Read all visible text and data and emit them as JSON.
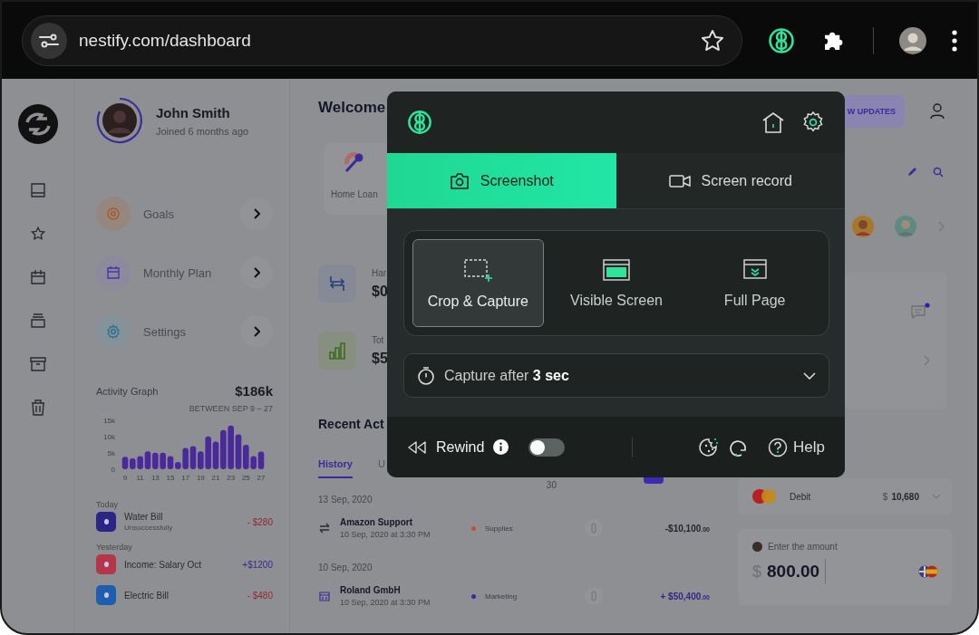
{
  "browser": {
    "url": "nestify.com/dashboard",
    "bookmarked": false
  },
  "profile": {
    "name": "John Smith",
    "joined": "Joined 6 months ago",
    "menu": [
      {
        "label": "Goals",
        "kind": "target"
      },
      {
        "label": "Monthly Plan",
        "kind": "calendar"
      },
      {
        "label": "Settings",
        "kind": "gear"
      }
    ]
  },
  "activity": {
    "title": "Activity Graph",
    "total": "$186k",
    "range": "BETWEEN SEP 9 – 27",
    "chart_data": {
      "type": "bar",
      "x": [
        9,
        10,
        11,
        12,
        13,
        14,
        15,
        16,
        17,
        18,
        19,
        20,
        21,
        22,
        23,
        24,
        25,
        26,
        27
      ],
      "values": [
        3.8,
        3.3,
        4.0,
        5.5,
        5.1,
        5.1,
        4.0,
        2.2,
        6.5,
        7.1,
        5.5,
        10.1,
        8.5,
        12.0,
        13.4,
        10.7,
        7.5,
        4.0,
        5.4
      ],
      "xlim": [
        9,
        27
      ],
      "ylim": [
        0,
        15
      ],
      "yticks": [
        {
          "value": 0,
          "label": "0"
        },
        {
          "value": 5,
          "label": "5k"
        },
        {
          "value": 10,
          "label": "10k"
        },
        {
          "value": 15,
          "label": "15k"
        }
      ],
      "xticks": [
        9,
        11,
        13,
        15,
        17,
        19,
        21,
        23,
        25,
        27
      ]
    }
  },
  "transactions": [
    {
      "group": "Today",
      "items": [
        {
          "title": "Water Bill",
          "subtitle": "Unsuccessfully",
          "amount": "- $280",
          "income": false,
          "color": "#2b2585"
        }
      ]
    },
    {
      "group": "Yesterday",
      "items": [
        {
          "title": "Income: Salary Oct",
          "amount": "+$1200",
          "income": true,
          "color": "#b5354a"
        },
        {
          "title": "Electric Bill",
          "amount": "- $480",
          "income": false,
          "color": "#1d5fae"
        }
      ]
    }
  ],
  "main": {
    "heading": "Welcome",
    "loan_label": "Home Loan",
    "stats": [
      {
        "kind": "transfer",
        "label": "Har",
        "value": "$0"
      },
      {
        "kind": "bars",
        "label": "Tot",
        "value": "$5"
      }
    ],
    "recent_heading": "Recent Act",
    "tabs": [
      {
        "label": "History",
        "selected": true
      },
      {
        "label": "U",
        "selected": false
      }
    ],
    "day_marker": "30",
    "days": [
      {
        "date": "13 Sep, 2020",
        "rows": [
          {
            "kind": "transfer",
            "title": "Amazon Support",
            "time": "10 Sep, 2020 at 3:30 PM",
            "category": "Supplies",
            "color": "#c0522e",
            "amount": "-$10,100",
            "cents": ".00",
            "income": false
          }
        ]
      },
      {
        "date": "10 Sep, 2020",
        "rows": [
          {
            "kind": "calendar",
            "title": "Roland GmbH",
            "time": "10 Sep, 2020 at 3:30 PM",
            "category": "Marketing",
            "color": "#3a2a9a",
            "amount": "+ $50,400",
            "cents": ".00",
            "income": true
          }
        ]
      }
    ]
  },
  "right": {
    "updates_button": "W UPDATES",
    "unread": true,
    "debit": {
      "label": "Debit",
      "currency": "$",
      "balance": "10,680"
    },
    "amount": {
      "label": "Enter the amount",
      "currency": "$",
      "value": "800.00"
    }
  },
  "popup": {
    "tabs": [
      {
        "label": "Screenshot",
        "kind": "camera",
        "selected": true
      },
      {
        "label": "Screen record",
        "kind": "video",
        "selected": false
      }
    ],
    "modes": [
      {
        "label": "Crop & Capture",
        "kind": "crop",
        "selected": true
      },
      {
        "label": "Visible Screen",
        "kind": "visible",
        "selected": false
      },
      {
        "label": "Full Page",
        "kind": "full",
        "selected": false
      }
    ],
    "delay": "Capture after **3 sec**",
    "rewind": {
      "label": "Rewind",
      "on": false
    },
    "help": "Help"
  }
}
